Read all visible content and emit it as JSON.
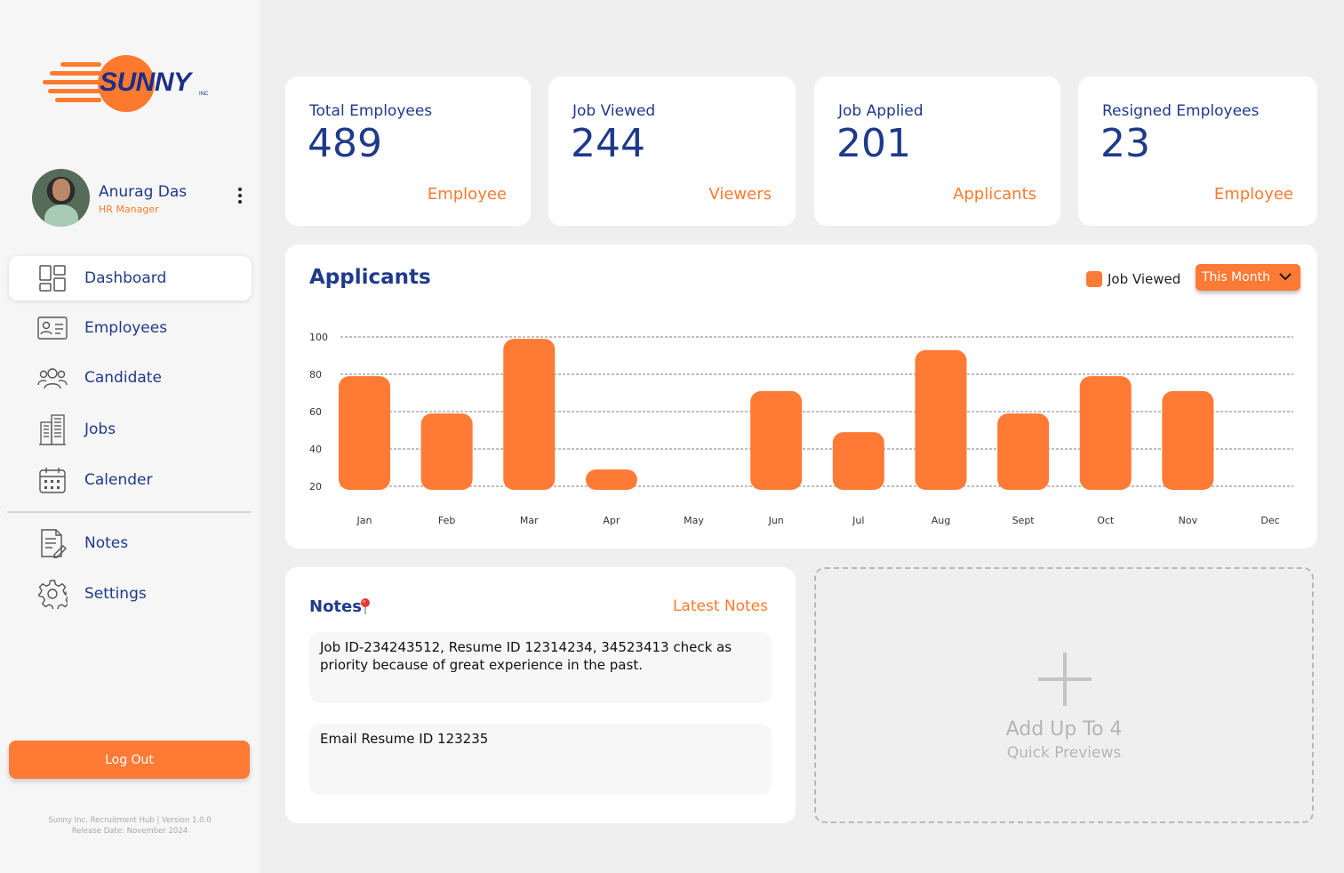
{
  "brand": {
    "name": "SUNNY",
    "suffix": "INC"
  },
  "profile": {
    "name": "Anurag Das",
    "role": "HR Manager"
  },
  "nav": [
    {
      "label": "Dashboard",
      "icon": "dashboard-icon",
      "active": true
    },
    {
      "label": "Employees",
      "icon": "id-card-icon"
    },
    {
      "label": "Candidate",
      "icon": "users-icon"
    },
    {
      "label": "Jobs",
      "icon": "building-icon"
    },
    {
      "label": "Calender",
      "icon": "calendar-icon"
    },
    {
      "label": "Notes",
      "icon": "notes-icon"
    },
    {
      "label": "Settings",
      "icon": "gear-icon"
    }
  ],
  "logout_label": "Log Out",
  "footer": {
    "line1": "Sunny Inc. Recruitment Hub | Version 1.0.0",
    "line2": "Release Date: November 2024"
  },
  "stats": [
    {
      "title": "Total Employees",
      "value": "489",
      "unit": "Employee"
    },
    {
      "title": "Job Viewed",
      "value": "244",
      "unit": "Viewers"
    },
    {
      "title": "Job Applied",
      "value": "201",
      "unit": "Applicants"
    },
    {
      "title": "Resigned Employees",
      "value": "23",
      "unit": "Employee"
    }
  ],
  "chart_card": {
    "title": "Applicants",
    "legend": "Job Viewed",
    "period": "This Month"
  },
  "chart_data": {
    "type": "bar",
    "categories": [
      "Jan",
      "Feb",
      "Mar",
      "Apr",
      "May",
      "Jun",
      "Jul",
      "Aug",
      "Sept",
      "Oct",
      "Nov",
      "Dec"
    ],
    "series": [
      {
        "name": "Job Viewed",
        "values": [
          79,
          59,
          99,
          29,
          null,
          71,
          49,
          93,
          59,
          79,
          71,
          null
        ]
      }
    ],
    "yticks": [
      "100",
      "80",
      "60",
      "40",
      "20"
    ],
    "ylim": [
      20,
      100
    ],
    "grid": true,
    "bar_color": "#ff7a35",
    "legend_position": "top-right"
  },
  "notes": {
    "title": "Notes",
    "latest": "Latest Notes",
    "items": [
      "Job ID-234243512, Resume ID 12314234, 34523413 check as priority because of great experience in the past.",
      "Email Resume ID 123235"
    ]
  },
  "quick_preview": {
    "title": "Add Up To 4",
    "subtitle": "Quick Previews"
  },
  "colors": {
    "accent": "#ff7a35",
    "primary": "#1f3a8a"
  }
}
